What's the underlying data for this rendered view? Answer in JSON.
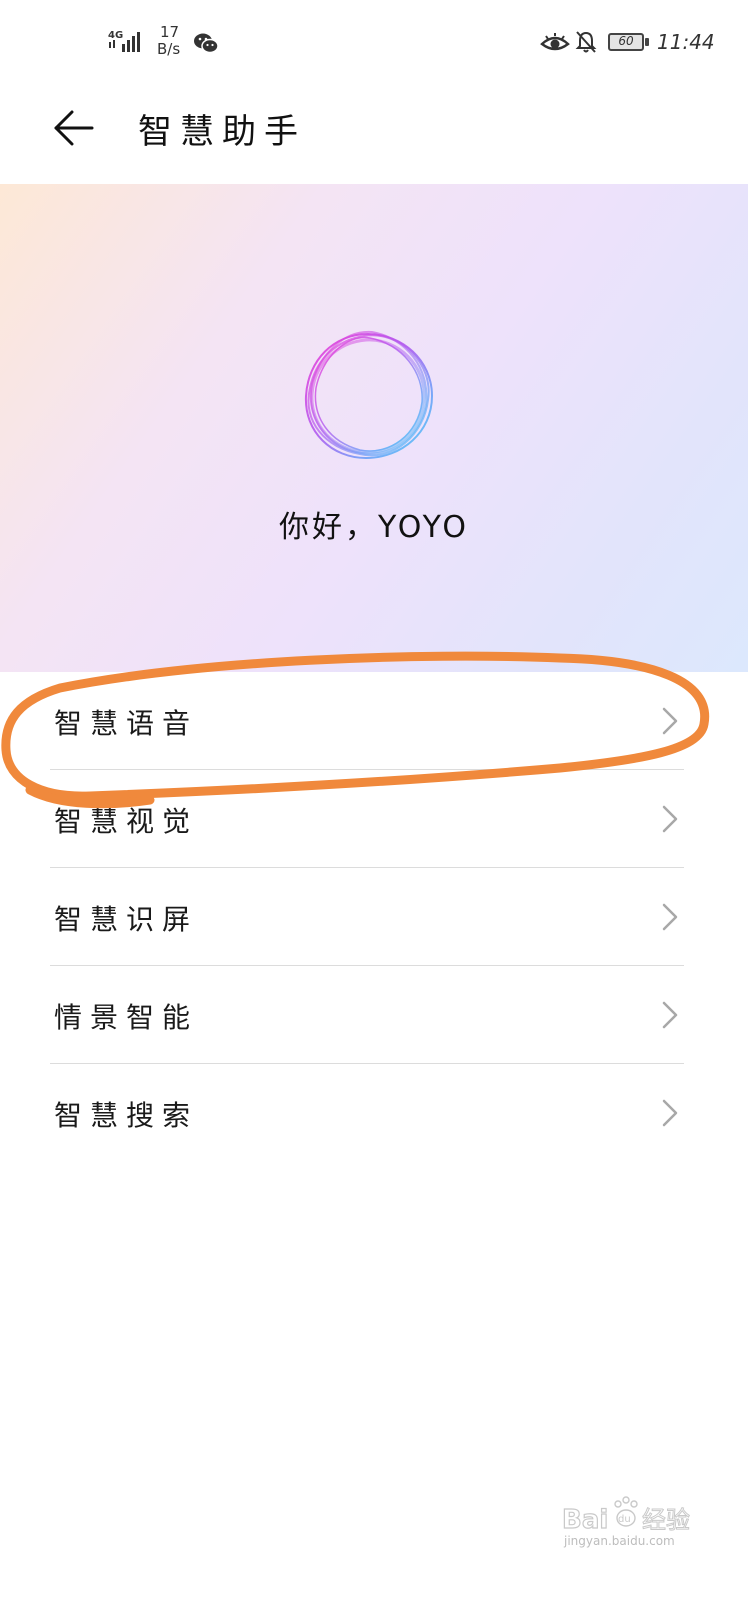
{
  "status_bar": {
    "network": "4G",
    "speed_value": "17",
    "speed_unit": "B/s",
    "battery": "60",
    "time": "11:44",
    "icons": [
      "signal-icon",
      "wechat-icon",
      "eye-comfort-icon",
      "bell-muted-icon",
      "battery-icon"
    ]
  },
  "header": {
    "title": "智慧助手",
    "back_icon": "back-arrow-icon"
  },
  "hero": {
    "greeting": "你好，YOYO"
  },
  "menu": {
    "items": [
      {
        "label": "智慧语音"
      },
      {
        "label": "智慧视觉"
      },
      {
        "label": "智慧识屏"
      },
      {
        "label": "情景智能"
      },
      {
        "label": "智慧搜索"
      }
    ]
  },
  "annotation": {
    "color": "#f0893c"
  },
  "watermark": {
    "brand": "Baidu经验",
    "url": "jingyan.baidu.com"
  }
}
